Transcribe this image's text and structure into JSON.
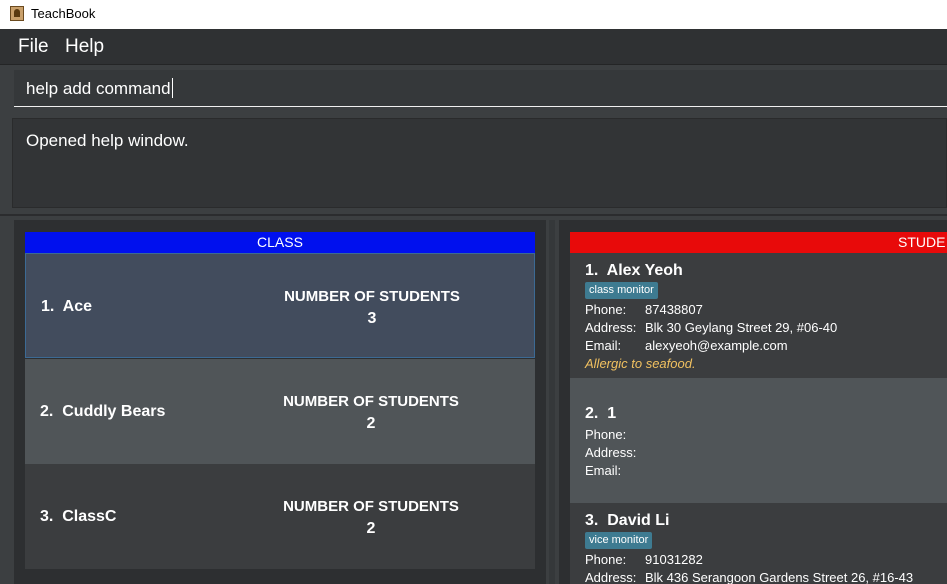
{
  "window": {
    "title": "TeachBook"
  },
  "menu": [
    {
      "label": "File"
    },
    {
      "label": "Help"
    }
  ],
  "command": {
    "value": "help add command"
  },
  "result": {
    "text": "Opened help window."
  },
  "class_panel": {
    "header": "CLASS",
    "classes": [
      {
        "index": "1.",
        "name": "Ace",
        "count_label": "NUMBER OF STUDENTS",
        "count": "3"
      },
      {
        "index": "2.",
        "name": "Cuddly Bears",
        "count_label": "NUMBER OF STUDENTS",
        "count": "2"
      },
      {
        "index": "3.",
        "name": "ClassC",
        "count_label": "NUMBER OF STUDENTS",
        "count": "2"
      }
    ]
  },
  "student_panel": {
    "header": "STUDE",
    "field_labels": {
      "phone": "Phone:",
      "address": "Address:",
      "email": "Email:"
    },
    "students": [
      {
        "index": "1.",
        "name": "Alex Yeoh",
        "tag": "class monitor",
        "phone": "87438807",
        "address": "Blk 30 Geylang Street 29, #06-40",
        "email": "alexyeoh@example.com",
        "remark": "Allergic to seafood."
      },
      {
        "index": "2.",
        "name": "1",
        "phone": "",
        "address": "",
        "email": ""
      },
      {
        "index": "3.",
        "name": "David Li",
        "tag": "vice monitor",
        "phone": "91031282",
        "address": "Blk 436 Serangoon Gardens Street 26, #16-43"
      }
    ]
  },
  "colors": {
    "class_header": "#0010ee",
    "student_header": "#e80a0a",
    "tag": "#3e7b91",
    "remark": "#f0c060"
  }
}
